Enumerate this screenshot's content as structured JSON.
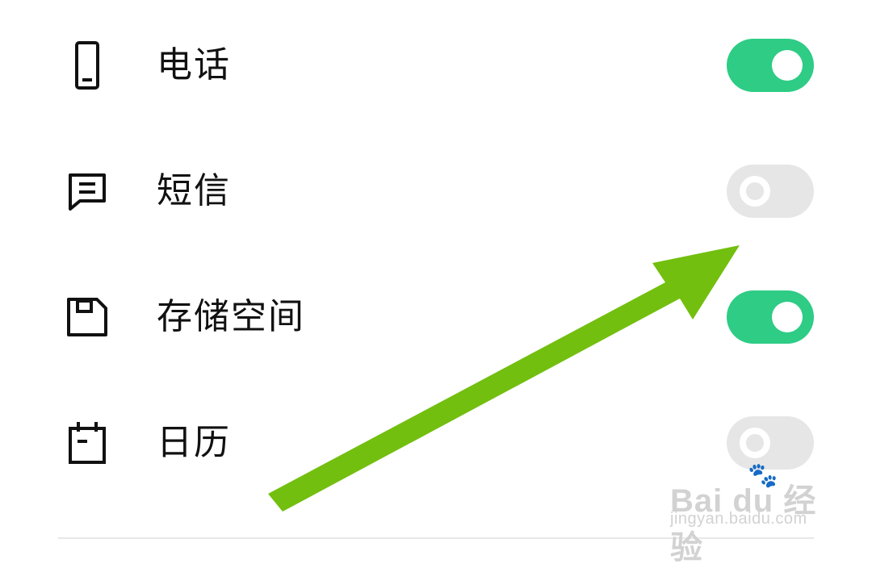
{
  "settings": {
    "items": [
      {
        "label": "电话",
        "icon": "phone-icon",
        "enabled": true
      },
      {
        "label": "短信",
        "icon": "message-icon",
        "enabled": false
      },
      {
        "label": "存储空间",
        "icon": "storage-icon",
        "enabled": true
      },
      {
        "label": "日历",
        "icon": "calendar-icon",
        "enabled": false
      }
    ]
  },
  "annotation": {
    "arrow_color": "#72bf0f"
  },
  "colors": {
    "toggle_on": "#2ecc85",
    "toggle_off": "#e6e6e6",
    "text": "#111111"
  },
  "watermark": {
    "logo_text": "Bai du 经验",
    "url": "jingyan.baidu.com"
  }
}
